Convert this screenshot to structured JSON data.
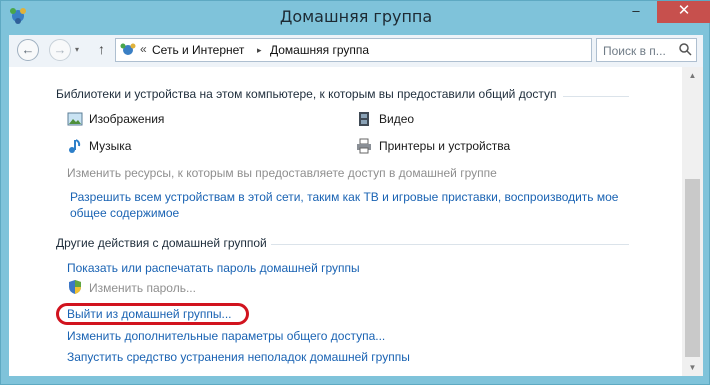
{
  "window": {
    "title": "Домашняя группа",
    "minimize_label": "–",
    "maximize_label": "□",
    "close_label": "✕"
  },
  "nav": {
    "back_icon": "back-arrow-icon",
    "forward_icon": "forward-arrow-icon",
    "up_icon": "up-arrow-icon",
    "breadcrumb_overflow": "«",
    "breadcrumb": [
      "Сеть и Интернет",
      "Домашняя группа"
    ],
    "breadcrumb_separator": "▸",
    "search_placeholder": "Поиск в п...",
    "refresh_icon": "refresh-icon"
  },
  "libraries": {
    "heading": "Библиотеки и устройства на этом компьютере, к которым вы предоставили общий доступ",
    "items": [
      {
        "label": "Изображения",
        "icon": "pictures-icon"
      },
      {
        "label": "Видео",
        "icon": "video-icon"
      },
      {
        "label": "Музыка",
        "icon": "music-icon"
      },
      {
        "label": "Принтеры и устройства",
        "icon": "printer-icon"
      }
    ],
    "change_resources": "Изменить ресурсы, к которым вы предоставляете доступ в домашней группе",
    "allow_devices_line1": "Разрешить всем устройствам в этой сети, таким как ТВ и игровые приставки, воспроизводить мое",
    "allow_devices_line2": "общее содержимое"
  },
  "other_actions": {
    "heading": "Другие действия с домашней группой",
    "show_password": "Показать или распечатать пароль домашней группы",
    "change_password": "Изменить пароль...",
    "leave_group": "Выйти из домашней группы...",
    "advanced_settings": "Изменить дополнительные параметры общего доступа...",
    "troubleshoot": "Запустить средство устранения неполадок домашней группы"
  },
  "colors": {
    "link": "#1a63b3",
    "highlight": "#d1131e",
    "disabled": "#8f8f8f",
    "frame": "#7fc3da"
  }
}
